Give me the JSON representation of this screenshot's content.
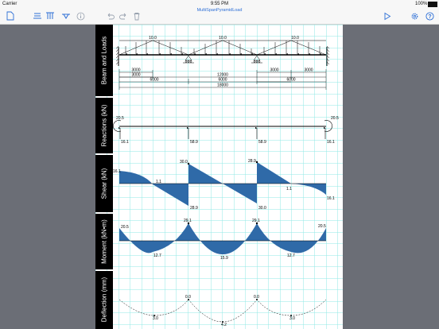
{
  "status": {
    "carrier": "Carrier",
    "time": "9:55 PM",
    "battery": "100%"
  },
  "document": {
    "title": "MultiSpanPyramidLoad"
  },
  "toolbar": {
    "icons": [
      "new-document-icon",
      "beam-icon",
      "columns-icon",
      "support-icon",
      "info-icon",
      "undo-icon",
      "redo-icon",
      "trash-icon",
      "play-icon",
      "settings-icon",
      "help-icon"
    ]
  },
  "sections": {
    "beam": "Beam and Loads",
    "reactions": "Reactions (kN)",
    "shear": "Shear (kN)",
    "moment": "Moment (kN•m)",
    "deflection": "Deflection (mm)"
  },
  "loads": {
    "peak1": "10.0",
    "peak2": "10.0",
    "peak3": "10.0"
  },
  "dimensions": {
    "d1": "3000",
    "d2": "3000",
    "d3": "6000",
    "d4": "12000",
    "d5": "6000",
    "d6": "3000",
    "d7": "3000",
    "d8": "6000",
    "total": "18000"
  },
  "reactions": {
    "left_moment": "20.5",
    "right_moment": "20.5",
    "r1": "16.1",
    "r2": "58.9",
    "r3": "58.9",
    "r4": "16.1"
  },
  "shear": {
    "v_left": "16.1",
    "v_s1": "1.1",
    "v_b1_top": "30.0",
    "v_b1_bot": "28.9",
    "v_b2_top": "28.9",
    "v_b2_bot": "30.0",
    "v_s3": "1.1",
    "v_right": "16.1"
  },
  "moment": {
    "m_left": "20.5",
    "m_span1": "12.7",
    "m_b1": "29.1",
    "m_span2": "15.9",
    "m_b2": "29.1",
    "m_span3": "12.7",
    "m_right": "20.5"
  },
  "deflection": {
    "d_span1": "3.0",
    "d_b1": "0.0",
    "d_span2": "4.2",
    "d_b2": "0.0",
    "d_span3": "3.0"
  }
}
